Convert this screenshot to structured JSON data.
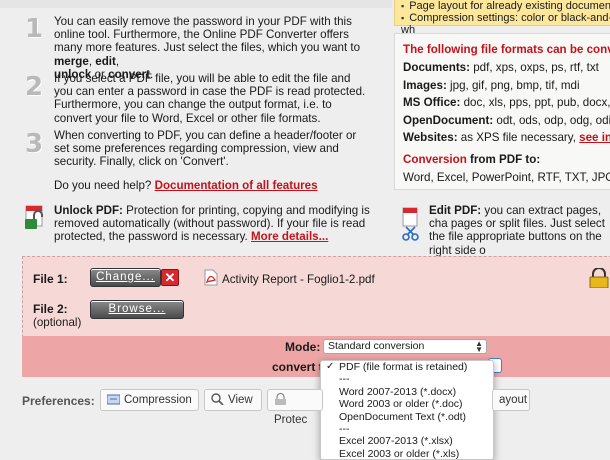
{
  "steps": [
    {
      "number": "1",
      "text": "You can easily remove the password in your PDF with this online tool. Furthermore, the Online PDF Converter offers many more features. Just select the files, which you want to ",
      "b1": "merge",
      "t2": ", ",
      "b2": "edit",
      "t3": ", ",
      "b3": "unlock",
      "t4": " or ",
      "b4": "convert",
      "t5": "."
    },
    {
      "number": "2",
      "text": "If you select a PDF file, you will be able to edit the file and you can enter a password in case the PDF is read protected. Furthermore, you can change the output format, i.e. to convert your file to Word, Excel or other file formats."
    },
    {
      "number": "3",
      "text": "When converting to PDF, you can define a header/footer or set some preferences regarding compression, view and security. Finally, click on 'Convert'."
    }
  ],
  "help": {
    "question": "Do you need help?",
    "link": "Documentation of all features"
  },
  "unlock": {
    "title": "Unlock PDF:",
    "text": " Protection for printing, copying and modifying is removed automatically (without password). If your file is read protected, the password is necessary. ",
    "link": "More details..."
  },
  "edit": {
    "title": "Edit PDF:",
    "text": " you can extract pages, cha pages or split files. Just select the file appropriate buttons on the right side o"
  },
  "right_top": {
    "items": [
      "Page layout for already existing documents",
      "Compression settings: color or black-and-wh"
    ]
  },
  "formats": {
    "heading": "The following file formats can be conv",
    "documents_label": "Documents:",
    "documents": " pdf, xps, oxps, ps, rtf, txt",
    "images_label": "Images:",
    "images": " jpg, gif, png, bmp, tif, mdi",
    "office_label": "MS Office:",
    "office": " doc, xls, pps, ppt, pub, docx, xls",
    "open_label": "OpenDocument:",
    "open": " odt, ods, odp, odg, odi, od",
    "web_label": "Websites:",
    "web": " as XPS file necessary, ",
    "web_link": "see instr",
    "from_heading_red": "Conversion",
    "from_heading": " from PDF to:",
    "from_list": "Word, Excel, PowerPoint, RTF, TXT, JPG"
  },
  "form": {
    "file1_label": "File 1:",
    "change_btn": "Change...",
    "remove_btn": "✕",
    "file1_name": "Activity Report - Foglio1-2.pdf",
    "file2_label": "File 2:",
    "file2_optional": "(optional)",
    "browse_btn": "Browse...",
    "mode_label": "Mode:",
    "mode_value": "Standard conversion",
    "convert_label": "convert to:"
  },
  "dropdown_options": [
    "PDF (file format is retained)",
    "---",
    "Word 2007-2013 (*.docx)",
    "Word 2003 or older (*.doc)",
    "OpenDocument Text (*.odt)",
    "---",
    "Excel 2007-2013 (*.xlsx)",
    "Excel 2003 or older (*.xls)"
  ],
  "preferences": {
    "label": "Preferences:",
    "compression": "Compression",
    "view": "View",
    "protection": "Protec",
    "layout": "ayout"
  },
  "colors": {
    "accent_red": "#c4121b",
    "form_bg": "#f6d9d7",
    "band": "#eea5a5"
  }
}
